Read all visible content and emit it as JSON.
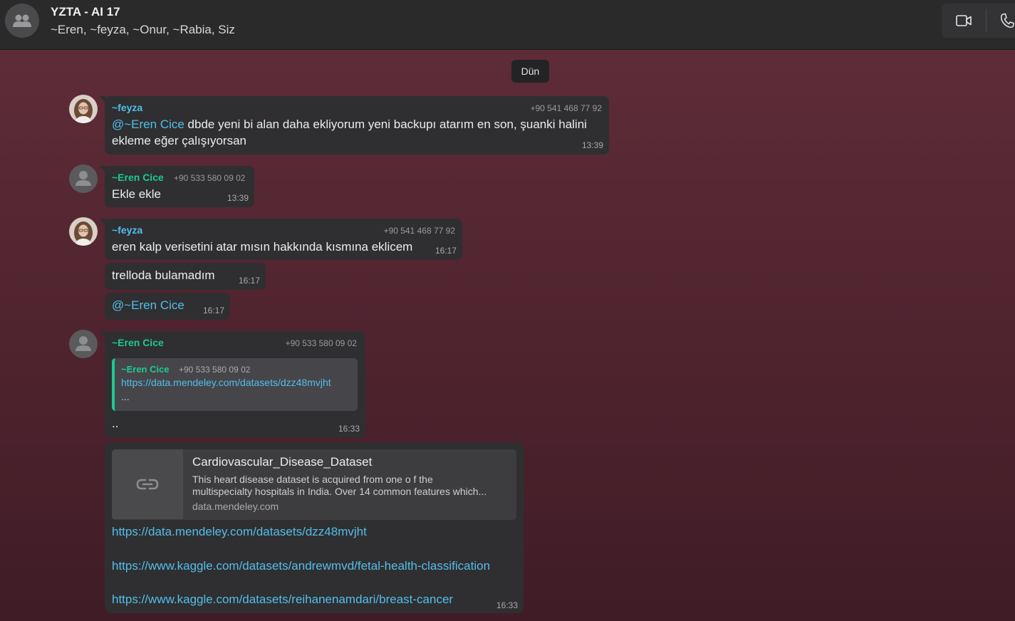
{
  "header": {
    "title": "YZTA - AI 17",
    "members": "~Eren, ~feyza, ~Onur, ~Rabia, Siz",
    "icons": [
      "group-icon",
      "video-call-icon",
      "voice-call-icon"
    ]
  },
  "chat": {
    "date_separator": "Dün",
    "messages": [
      {
        "sender": "~feyza",
        "phone": "+90 541 468 77 92",
        "mention": "@~Eren Cice",
        "text_line1": " dbde yeni bi alan daha ekliyorum yeni backupı atarım en son, şuanki halini",
        "text_line2": "ekleme eğer çalışıyorsan",
        "time": "13:39"
      },
      {
        "sender": "~Eren Cice",
        "phone": "+90 533 580 09 02",
        "text": "Ekle ekle",
        "time": "13:39"
      },
      {
        "sender": "~feyza",
        "phone": "+90 541 468 77 92",
        "text": "eren kalp verisetini atar mısın hakkında kısmına eklicem",
        "time": "16:17"
      },
      {
        "text": "trelloda bulamadım",
        "time": "16:17"
      },
      {
        "mention": "@~Eren Cice",
        "time": "16:17"
      },
      {
        "sender": "~Eren Cice",
        "phone": "+90 533 580 09 02",
        "quote": {
          "sender": "~Eren Cice",
          "phone": "+90 533 580 09 02",
          "link": "https://data.mendeley.com/datasets/dzz48mvjht",
          "ellipsis": "..."
        },
        "text": "..",
        "time": "16:33"
      },
      {
        "preview": {
          "title": "Cardiovascular_Disease_Dataset",
          "desc_line1": "This heart disease dataset is acquired from one o f the",
          "desc_line2": "multispecialty hospitals in India. Over 14 common features which...",
          "domain": "data.mendeley.com"
        },
        "links": [
          "https://data.mendeley.com/datasets/dzz48mvjht",
          "https://www.kaggle.com/datasets/andrewmvd/fetal-health-classification",
          "https://www.kaggle.com/datasets/reihanenamdari/breast-cancer"
        ],
        "time": "16:33"
      }
    ]
  },
  "colors": {
    "feyza_name": "#53bdeb",
    "eren_name": "#1fc991",
    "link": "#53bdeb",
    "bubble": "#2f2f31",
    "chat_bg": "#5e2c38"
  }
}
